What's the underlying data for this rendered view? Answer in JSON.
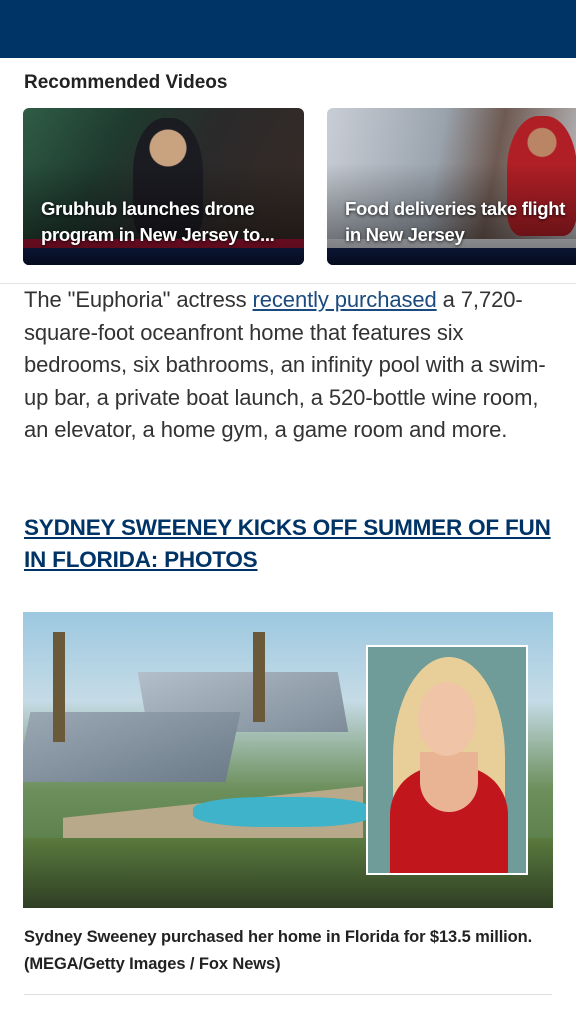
{
  "header": {
    "background_color": "#003366"
  },
  "recommended": {
    "title": "Recommended Videos",
    "videos": [
      {
        "title_line1": "Grubhub launches drone",
        "title_line2": "program in New Jersey to..."
      },
      {
        "title_line1": "Food deliveries take flight",
        "title_line2": "in New Jersey"
      }
    ]
  },
  "article": {
    "text_before_link": "The \"Euphoria\" actress ",
    "link_text": "recently purchased",
    "text_after_link": " a 7,720-square-foot oceanfront home that features six bedrooms, six bathrooms, an infinity pool with a swim-up bar, a private boat launch, a 520-bottle wine room, an elevator, a home gym, a game room and more.",
    "related_headline": "SYDNEY SWEENEY KICKS OFF SUMMER OF FUN IN FLORIDA: PHOTOS",
    "image_caption": "Sydney Sweeney purchased her home in Florida for $13.5 million. (MEGA/Getty Images / Fox News)"
  },
  "colors": {
    "link": "#1a4a7e",
    "headline": "#003366"
  }
}
